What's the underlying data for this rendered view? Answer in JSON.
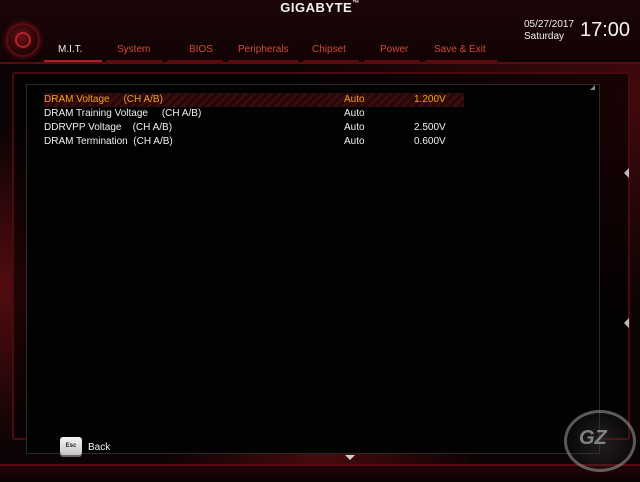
{
  "brand": "GIGABYTE",
  "brand_mark": "™",
  "tabs": [
    {
      "label": "M.I.T.",
      "active": true
    },
    {
      "label": "System",
      "active": false
    },
    {
      "label": "BIOS",
      "active": false
    },
    {
      "label": "Peripherals",
      "active": false
    },
    {
      "label": "Chipset",
      "active": false
    },
    {
      "label": "Power",
      "active": false
    },
    {
      "label": "Save & Exit",
      "active": false
    }
  ],
  "datetime": {
    "date": "05/27/2017",
    "day": "Saturday",
    "time": "17:00"
  },
  "settings": [
    {
      "name": "DRAM Voltage     (CH A/B)",
      "value": "Auto",
      "current": "1.200V",
      "selected": true
    },
    {
      "name": "DRAM Training Voltage     (CH A/B)",
      "value": "Auto",
      "current": "",
      "selected": false
    },
    {
      "name": "DDRVPP Voltage    (CH A/B)",
      "value": "Auto",
      "current": "2.500V",
      "selected": false
    },
    {
      "name": "DRAM Termination  (CH A/B)",
      "value": "Auto",
      "current": "0.600V",
      "selected": false
    }
  ],
  "footer": {
    "esc_key": "Esc",
    "back_label": "Back"
  },
  "colors": {
    "accent": "#b01e26",
    "tab_inactive": "#d24a3a",
    "selected_text": "#f0a020"
  }
}
